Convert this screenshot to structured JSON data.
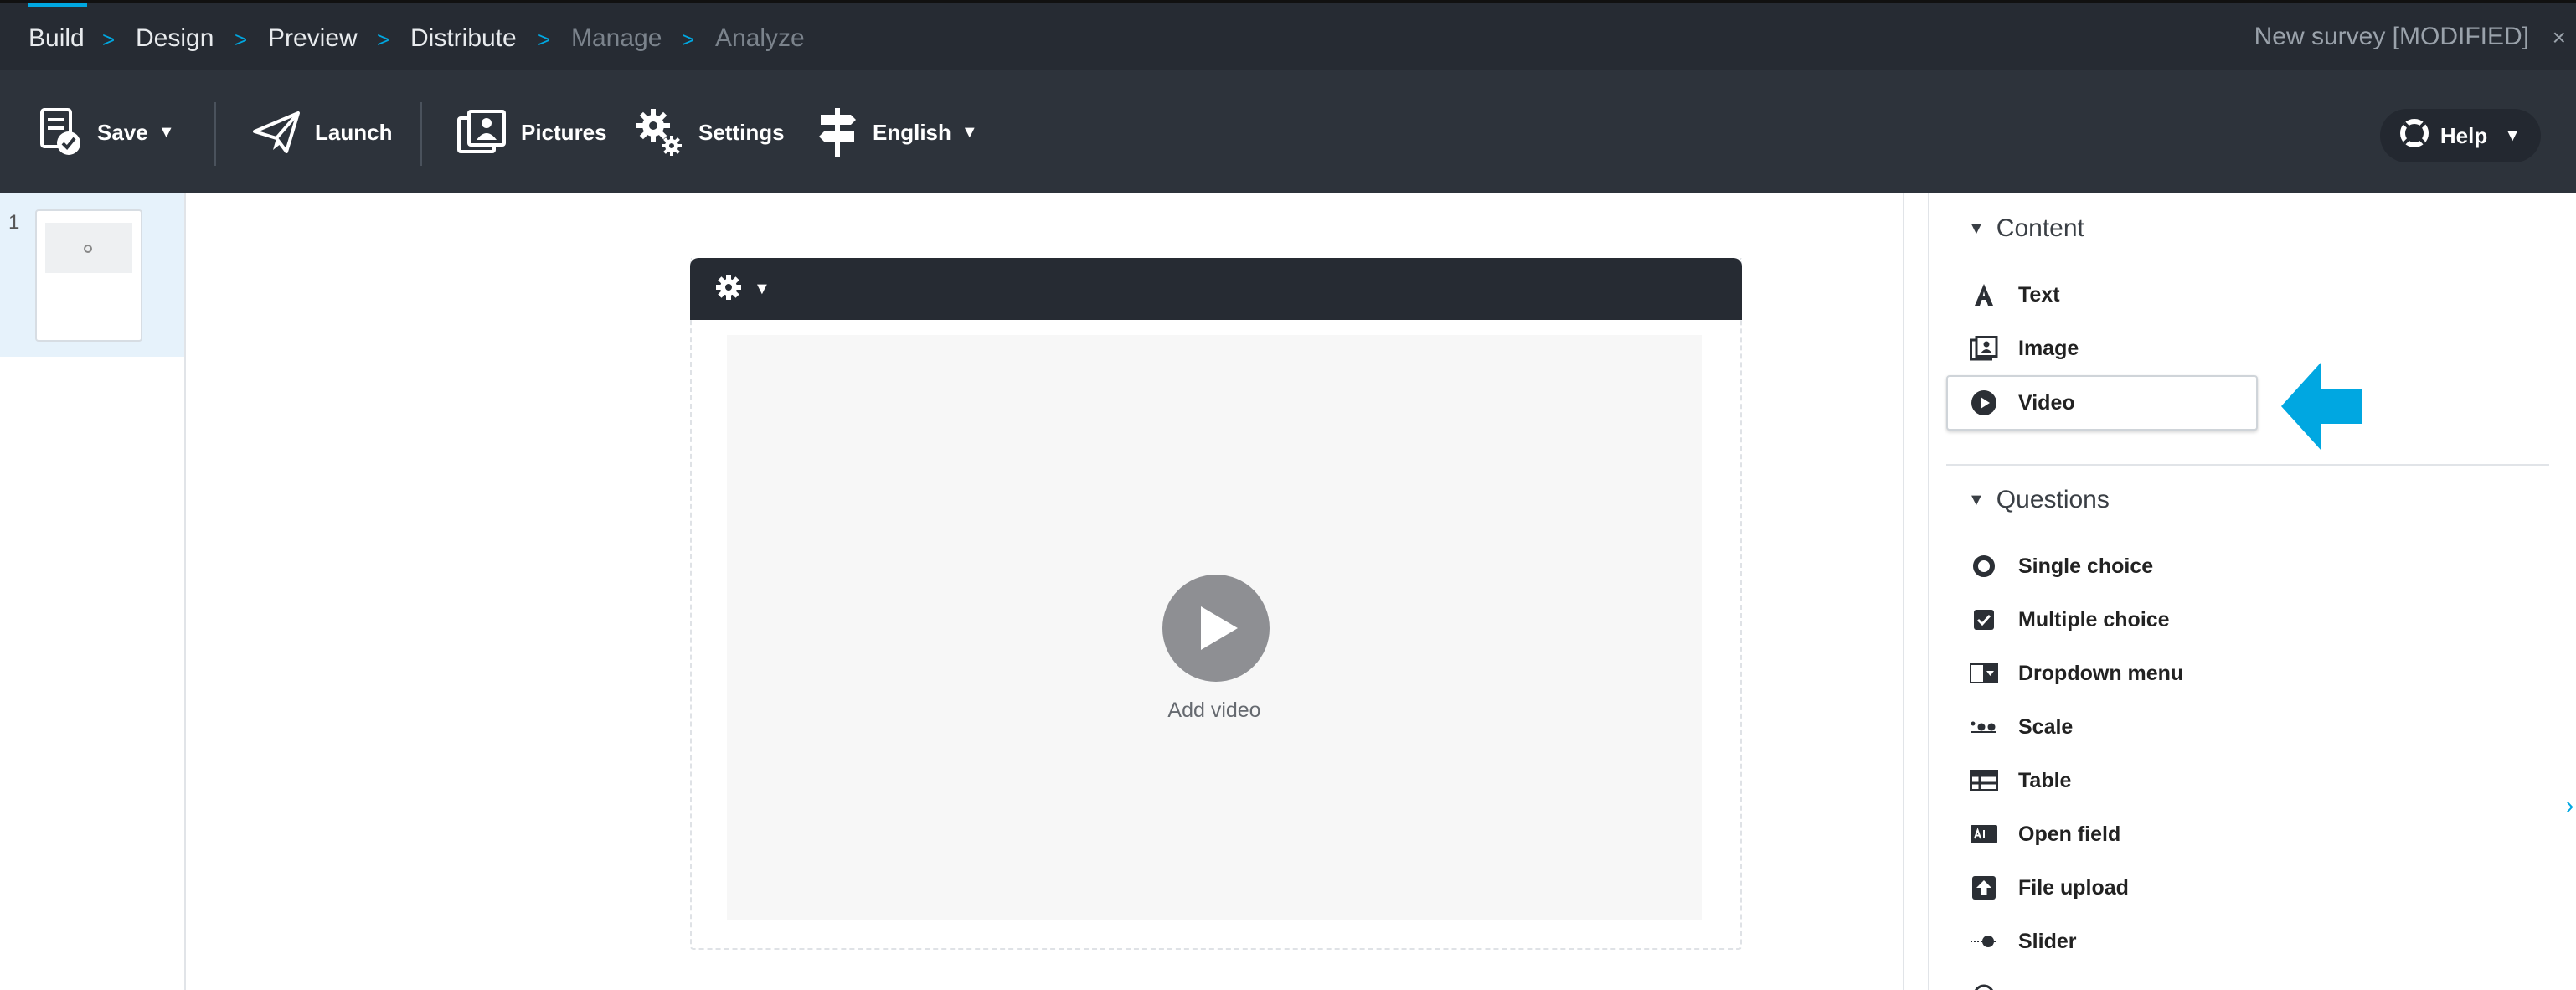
{
  "breadcrumb": {
    "items": [
      {
        "label": "Build",
        "state": "active"
      },
      {
        "label": "Design",
        "state": "enabled"
      },
      {
        "label": "Preview",
        "state": "enabled"
      },
      {
        "label": "Distribute",
        "state": "enabled"
      },
      {
        "label": "Manage",
        "state": "disabled"
      },
      {
        "label": "Analyze",
        "state": "disabled"
      }
    ],
    "separator": ">"
  },
  "survey_title": "New survey [MODIFIED]",
  "close_glyph": "×",
  "toolbar": {
    "save_label": "Save",
    "launch_label": "Launch",
    "pictures_label": "Pictures",
    "settings_label": "Settings",
    "language_label": "English",
    "help_label": "Help"
  },
  "pages": {
    "items": [
      {
        "number": "1",
        "selected": true
      }
    ]
  },
  "canvas": {
    "add_video_label": "Add video"
  },
  "panel": {
    "content": {
      "title": "Content",
      "items": [
        {
          "label": "Text",
          "icon": "text-icon"
        },
        {
          "label": "Image",
          "icon": "image-icon"
        },
        {
          "label": "Video",
          "icon": "video-icon",
          "highlighted": true
        }
      ]
    },
    "questions": {
      "title": "Questions",
      "items": [
        {
          "label": "Single choice",
          "icon": "radio-icon"
        },
        {
          "label": "Multiple choice",
          "icon": "checkbox-icon"
        },
        {
          "label": "Dropdown menu",
          "icon": "dropdown-icon"
        },
        {
          "label": "Scale",
          "icon": "scale-icon"
        },
        {
          "label": "Table",
          "icon": "table-icon"
        },
        {
          "label": "Open field",
          "icon": "open-field-icon"
        },
        {
          "label": "File upload",
          "icon": "file-upload-icon"
        },
        {
          "label": "Slider",
          "icon": "slider-icon"
        }
      ]
    }
  },
  "colors": {
    "accent": "#00a7e1",
    "nav_bg": "#262b33",
    "toolbar_bg": "#2d333b",
    "canvas_video_bg": "#f7f7f7",
    "play_button": "#8e8f93"
  }
}
